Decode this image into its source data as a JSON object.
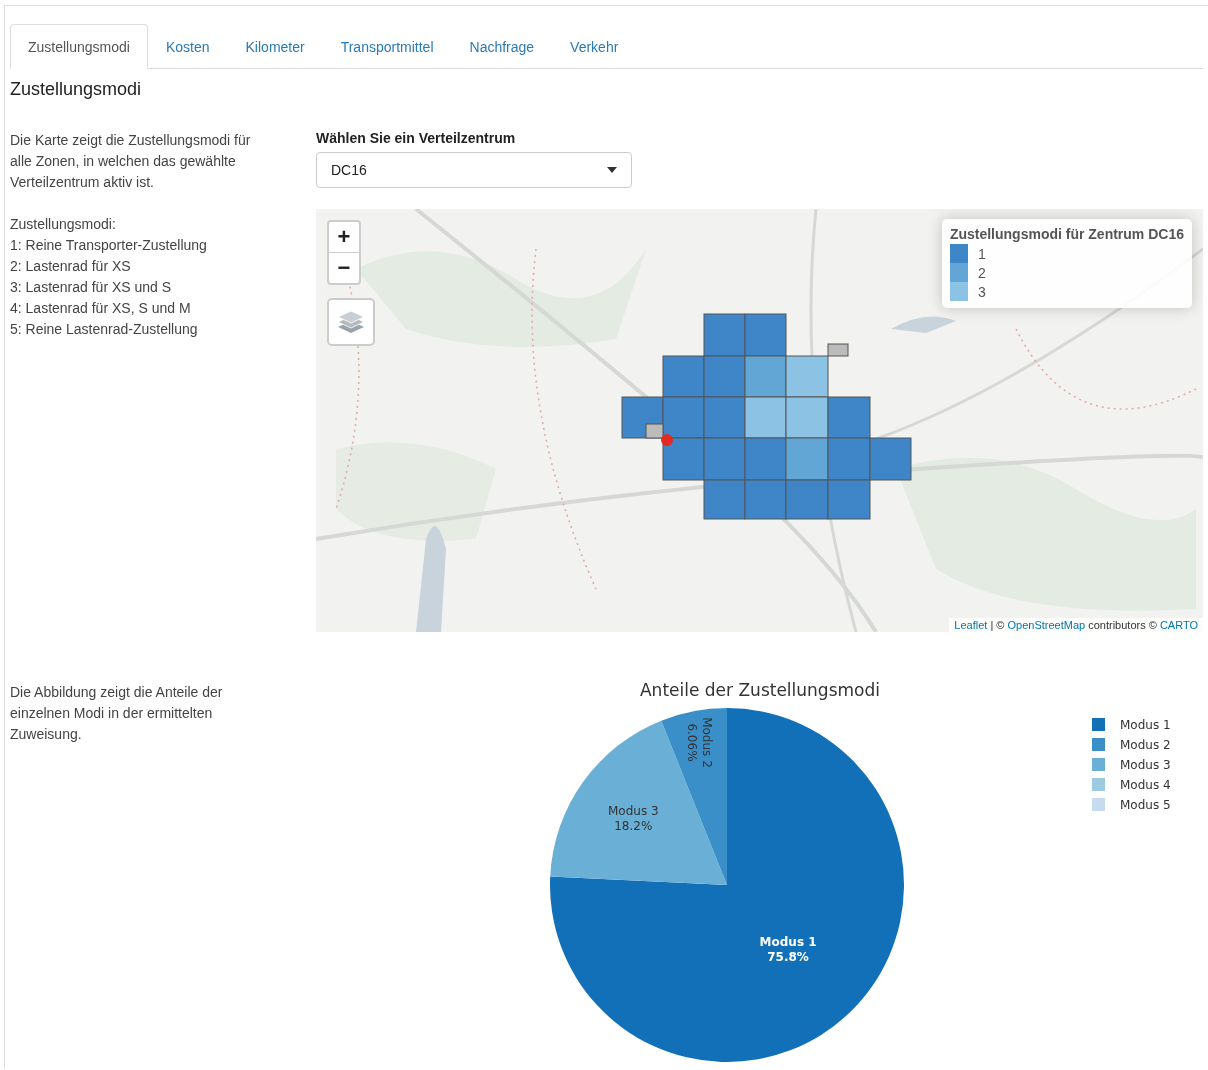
{
  "tabs": [
    {
      "label": "Zustellungsmodi",
      "selected": true
    },
    {
      "label": "Kosten",
      "selected": false
    },
    {
      "label": "Kilometer",
      "selected": false
    },
    {
      "label": "Transportmittel",
      "selected": false
    },
    {
      "label": "Nachfrage",
      "selected": false
    },
    {
      "label": "Verkehr",
      "selected": false
    }
  ],
  "heading": "Zustellungsmodi",
  "map_section": {
    "description": "Die Karte zeigt die Zustellungsmodi für alle Zonen, in welchen das gewählte Verteilzentrum aktiv ist.",
    "modes_heading": "Zustellungsmodi:",
    "modes": [
      "1: Reine Transporter-Zustellung",
      "2: Lastenrad für XS",
      "3: Lastenrad für XS und S",
      "4: Lastenrad für XS, S und M",
      "5: Reine Lastenrad-Zustellung"
    ],
    "select": {
      "label": "Wählen Sie ein Verteilzentrum",
      "value": "DC16"
    },
    "map": {
      "zoom_in": "+",
      "zoom_out": "−",
      "legend": {
        "title": "Zustellungsmodi für Zentrum DC16",
        "items": [
          {
            "label": "1",
            "color": "#3f86c8"
          },
          {
            "label": "2",
            "color": "#62a6d6"
          },
          {
            "label": "3",
            "color": "#8cc2e3"
          }
        ]
      },
      "attribution": [
        {
          "text": "Leaflet",
          "kind": "link"
        },
        {
          "text": "| ©",
          "kind": "text"
        },
        {
          "text": "OpenStreetMap",
          "kind": "link"
        },
        {
          "text": "contributors ©",
          "kind": "text"
        },
        {
          "text": "CARTO",
          "kind": "link"
        }
      ]
    }
  },
  "chart_section": {
    "description": "Die Abbildung zeigt die Anteile der einzelnen Modi in der ermittelten Zuweisung.",
    "chart_data": {
      "type": "pie",
      "title": "Anteile der Zustellungsmodi",
      "categories": [
        "Modus 1",
        "Modus 2",
        "Modus 3",
        "Modus 4",
        "Modus 5"
      ],
      "values": [
        75.8,
        6.06,
        18.2,
        0,
        0
      ],
      "value_labels": [
        "75.8%",
        "6.06%",
        "18.2%",
        null,
        null
      ],
      "legend": [
        {
          "color": "#1170b8"
        },
        {
          "color": "#3b8fc8"
        },
        {
          "color": "#6aafd6"
        },
        {
          "color": "#9ecae1"
        },
        {
          "color": "#c6dbef"
        }
      ]
    }
  }
}
